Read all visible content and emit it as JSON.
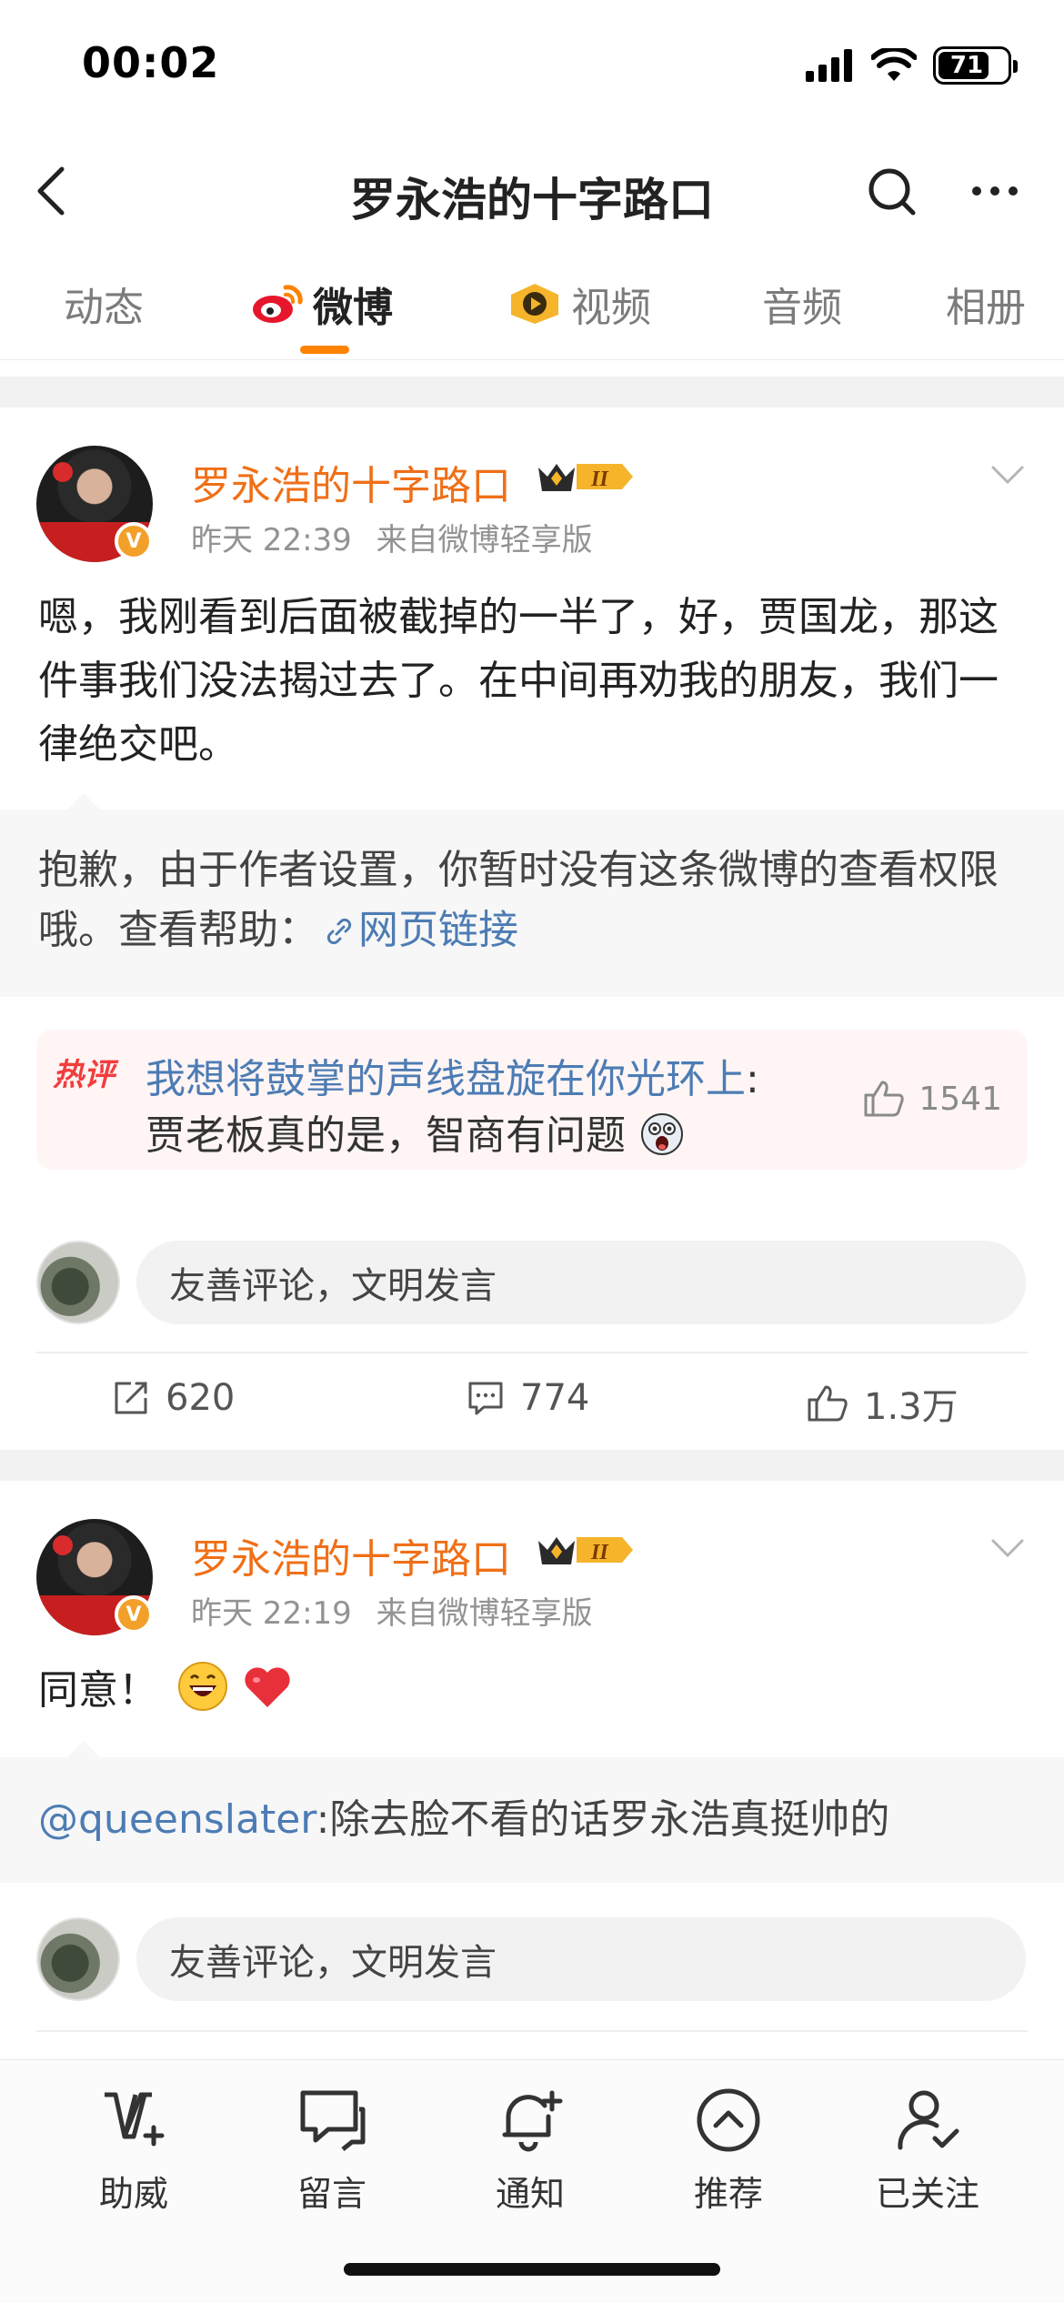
{
  "status_bar": {
    "time": "00:02",
    "battery": "71",
    "battery_level": 0.71
  },
  "nav": {
    "title": "罗永浩的十字路口"
  },
  "tabs": [
    {
      "label": "动态"
    },
    {
      "label": "微博"
    },
    {
      "label": "视频"
    },
    {
      "label": "音频"
    },
    {
      "label": "相册"
    }
  ],
  "active_tab": "微博",
  "posts": [
    {
      "author": "罗永浩的十字路口",
      "vip_level": "II",
      "time": "昨天 22:39",
      "source": "来自微博轻享版",
      "text": "嗯，我刚看到后面被截掉的一半了，好，贾国龙，那这件事我们没法揭过去了。在中间再劝我的朋友，我们一律绝交吧。",
      "repost_text": "抱歉，由于作者设置，你暂时没有这条微博的查看权限哦。查看帮助：",
      "repost_link": "网页链接",
      "hot_comment": {
        "badge": "热评",
        "user": "我想将鼓掌的声线盘旋在你光环上",
        "colon": ":",
        "text": "贾老板真的是，智商有问题",
        "likes": "1541"
      },
      "comment_placeholder": "友善评论，文明发言",
      "reposts": "620",
      "comments": "774",
      "likes": "1.3万"
    },
    {
      "author": "罗永浩的十字路口",
      "vip_level": "II",
      "time": "昨天 22:19",
      "source": "来自微博轻享版",
      "text": "同意！",
      "repost_user": "@queenslater",
      "repost_text": ":除去脸不看的话罗永浩真挺帅的",
      "comment_placeholder": "友善评论，文明发言"
    }
  ],
  "bottom_bar": [
    {
      "label": "助威",
      "icon": "cheer-icon"
    },
    {
      "label": "留言",
      "icon": "message-icon"
    },
    {
      "label": "通知",
      "icon": "bell-icon"
    },
    {
      "label": "推荐",
      "icon": "recommend-icon"
    },
    {
      "label": "已关注",
      "icon": "followed-icon"
    }
  ],
  "colors": {
    "accent": "#ff8200",
    "author": "#f06f17",
    "link": "#4d7cb4",
    "hot": "#f23d3d"
  }
}
